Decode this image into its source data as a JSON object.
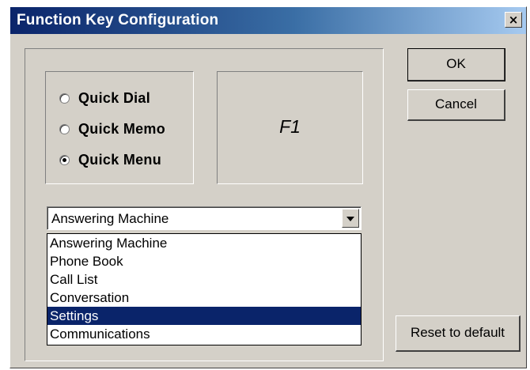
{
  "window": {
    "title": "Function Key Configuration",
    "close_glyph": "×"
  },
  "options": {
    "selected": "Quick Menu",
    "items": [
      {
        "label": "Quick Dial",
        "checked": false
      },
      {
        "label": "Quick Memo",
        "checked": false
      },
      {
        "label": "Quick Menu",
        "checked": true
      }
    ]
  },
  "function_key": "F1",
  "combo": {
    "value": "Answering Machine",
    "open": true
  },
  "dropdown": {
    "items": [
      "Answering Machine",
      "Phone Book",
      "Call List",
      "Conversation",
      "Settings",
      "Communications"
    ],
    "highlighted": "Settings"
  },
  "buttons": {
    "ok": "OK",
    "cancel": "Cancel",
    "reset": "Reset to default"
  },
  "colors": {
    "title_bar_start": "#0a246a",
    "title_bar_end": "#a6caf0",
    "selection": "#0a246a",
    "dialog_face": "#d4d0c8"
  },
  "icons": {
    "close": "close-icon",
    "dropdown_arrow": "chevron-down-icon"
  }
}
